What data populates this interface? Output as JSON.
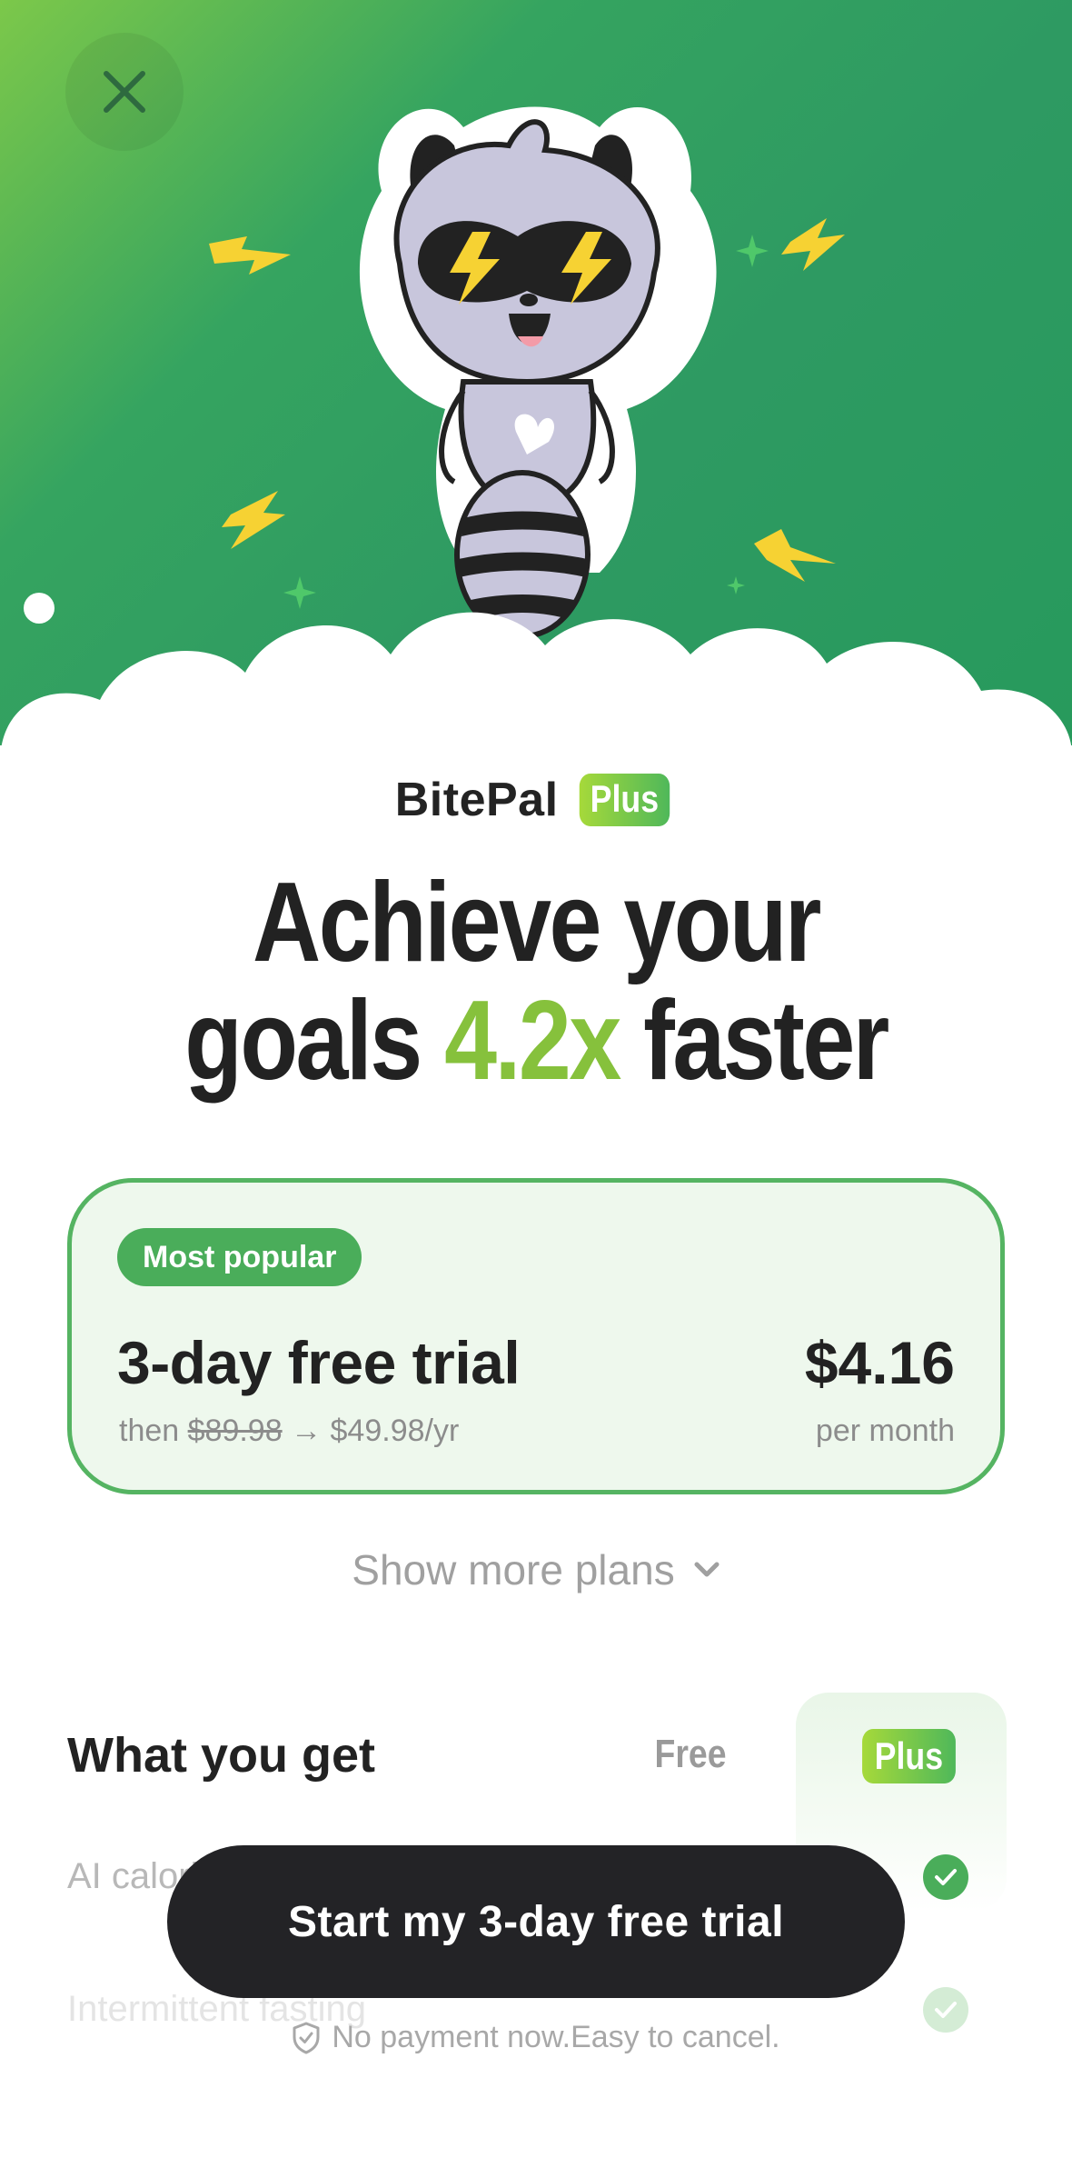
{
  "brand": {
    "name": "BitePal",
    "badge": "Plus"
  },
  "headline": {
    "line1": "Achieve your",
    "line2_prefix": "goals ",
    "line2_accent": "4.2x",
    "line2_suffix": " faster"
  },
  "plan": {
    "badge": "Most popular",
    "title": "3-day free trial",
    "sub_prefix": "then ",
    "old_price": "$89.98",
    "sub_suffix": " → $49.98/yr",
    "price": "$4.16",
    "period": "per month"
  },
  "more_plans": {
    "label": "Show more plans"
  },
  "features": {
    "title": "What you get",
    "col_free": "Free",
    "col_plus": "Plus",
    "rows": [
      {
        "label": "AI calorie tracking"
      },
      {
        "label": "Intermittent fasting"
      }
    ]
  },
  "cta": {
    "label": "Start my 3-day free trial"
  },
  "fineprint": {
    "label": "No payment now.Easy to cancel."
  },
  "colors": {
    "accent_green": "#4aad5a",
    "lime": "#86c13c",
    "cta_dark": "#232326"
  },
  "icons": {
    "close": "close-icon",
    "chevron": "chevron-down-icon",
    "shield": "shield-check-icon",
    "check": "check-icon"
  }
}
